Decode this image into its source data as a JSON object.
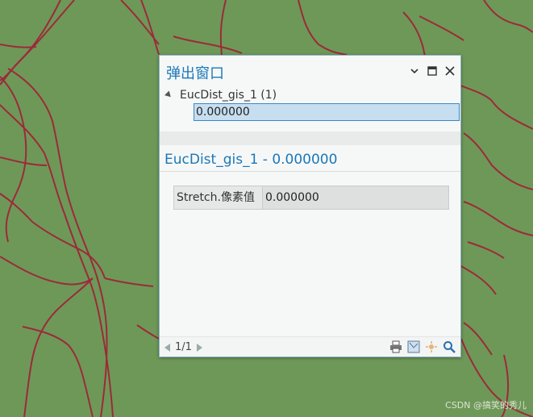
{
  "popup": {
    "title": "弹出窗口",
    "layer_label": "EucDist_gis_1 (1)",
    "selected_value": "0.000000",
    "detail_header": "EucDist_gis_1 - 0.000000",
    "fields": [
      {
        "name": "Stretch.像素值",
        "value": "0.000000"
      }
    ],
    "pager": "1/1"
  },
  "icons": {
    "minimize_menu": "chevron-down-icon",
    "maximize": "maximize-icon",
    "close": "close-icon",
    "print": "print-icon",
    "zoom_to": "zoom-to-icon",
    "flash": "flash-icon",
    "search": "search-icon"
  },
  "colors": {
    "map_background": "#6e9858",
    "road_lines": "#9b2b3a",
    "title_text": "#1b77b8",
    "selection": "#c6def0"
  },
  "watermark": "CSDN @搞笑的秀儿"
}
